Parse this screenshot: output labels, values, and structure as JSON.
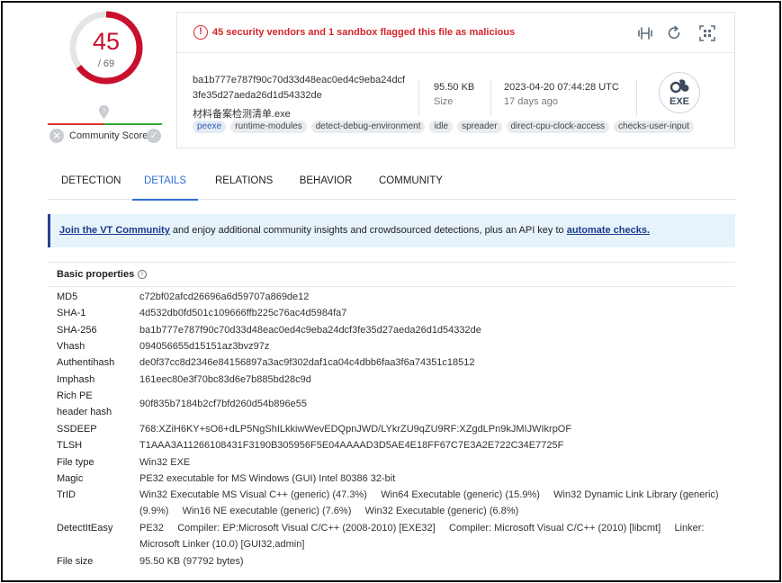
{
  "score": {
    "detections": "45",
    "total": "/ 69",
    "colors": {
      "ring": "#c8102e",
      "track": "#e5e5e5"
    }
  },
  "community": {
    "label": "Community Score",
    "pin_icon": "map-pin-icon",
    "negative_icon": "x-icon",
    "positive_icon": "check-icon"
  },
  "summary": {
    "alert": "45 security vendors and 1 sandbox flagged this file as malicious",
    "hash_line1": "ba1b777e787f90c70d33d48eac0ed4c9eba24dcf",
    "hash_line2": "3fe35d27aeda26d1d54332de",
    "file_name": "材料备案检测清单.exe",
    "tags": [
      "peexe",
      "runtime-modules",
      "detect-debug-environment",
      "idle",
      "spreader",
      "direct-cpu-clock-access",
      "checks-user-input"
    ],
    "size_value": "95.50 KB",
    "size_label": "Size",
    "date_value": "2023-04-20 07:44:28 UTC",
    "date_label": "17 days ago",
    "file_type_badge": "EXE",
    "toolbar_icons": [
      "compare-icon",
      "reanalyze-icon",
      "qr-scan-icon"
    ]
  },
  "tabs": [
    "DETECTION",
    "DETAILS",
    "RELATIONS",
    "BEHAVIOR",
    "COMMUNITY"
  ],
  "active_tab": "DETAILS",
  "banner": {
    "link1": "Join the VT Community",
    "middle": " and enjoy additional community insights and crowdsourced detections, plus an API key to ",
    "link2": "automate checks."
  },
  "basic_properties": {
    "title": "Basic properties",
    "rows": [
      {
        "label": "MD5",
        "value": "c72bf02afcd26696a6d59707a869de12"
      },
      {
        "label": "SHA-1",
        "value": "4d532db0fd501c109666ffb225c76ac4d5984fa7"
      },
      {
        "label": "SHA-256",
        "value": "ba1b777e787f90c70d33d48eac0ed4c9eba24dcf3fe35d27aeda26d1d54332de"
      },
      {
        "label": "Vhash",
        "value": "094056655d15151az3bvz97z"
      },
      {
        "label": "Authentihash",
        "value": "de0f37cc8d2346e84156897a3ac9f302daf1ca04c4dbb6faa3f6a74351c18512"
      },
      {
        "label": "Imphash",
        "value": "161eec80e3f70bc83d6e7b885bd28c9d"
      },
      {
        "label": "Rich PE",
        "label2": "header hash",
        "value": "90f835b7184b2cf7bfd260d54b896e55"
      },
      {
        "label": "SSDEEP",
        "value": "768:XZiH6KY+sO6+dLP5NgShILkkiwWevEDQpnJWD/LYkrZU9qZU9RF:XZgdLPn9kJMIJWIkrpOF"
      },
      {
        "label": "TLSH",
        "value": "T1AAA3A11266108431F3190B305956F5E04AAAAD3D5AE4E18FF67C7E3A2E722C34E7725F"
      },
      {
        "label": "File type",
        "value": "Win32 EXE"
      },
      {
        "label": "Magic",
        "value": "PE32 executable for MS Windows (GUI) Intel 80386 32-bit"
      },
      {
        "label": "TrID",
        "value": "Win32 Executable MS Visual C++ (generic) (47.3%)     Win64 Executable (generic) (15.9%)     Win32 Dynamic Link Library (generic)",
        "value2": "(9.9%)     Win16 NE executable (generic) (7.6%)     Win32 Executable (generic) (6.8%)"
      },
      {
        "label": "DetectItEasy",
        "value": "PE32     Compiler: EP:Microsoft Visual C/C++ (2008-2010) [EXE32]     Compiler: Microsoft Visual C/C++ (2010) [libcmt]     Linker:",
        "value2": "Microsoft Linker (10.0) [GUI32,admin]"
      },
      {
        "label": "File size",
        "value": "95.50 KB (97792 bytes)"
      }
    ]
  }
}
